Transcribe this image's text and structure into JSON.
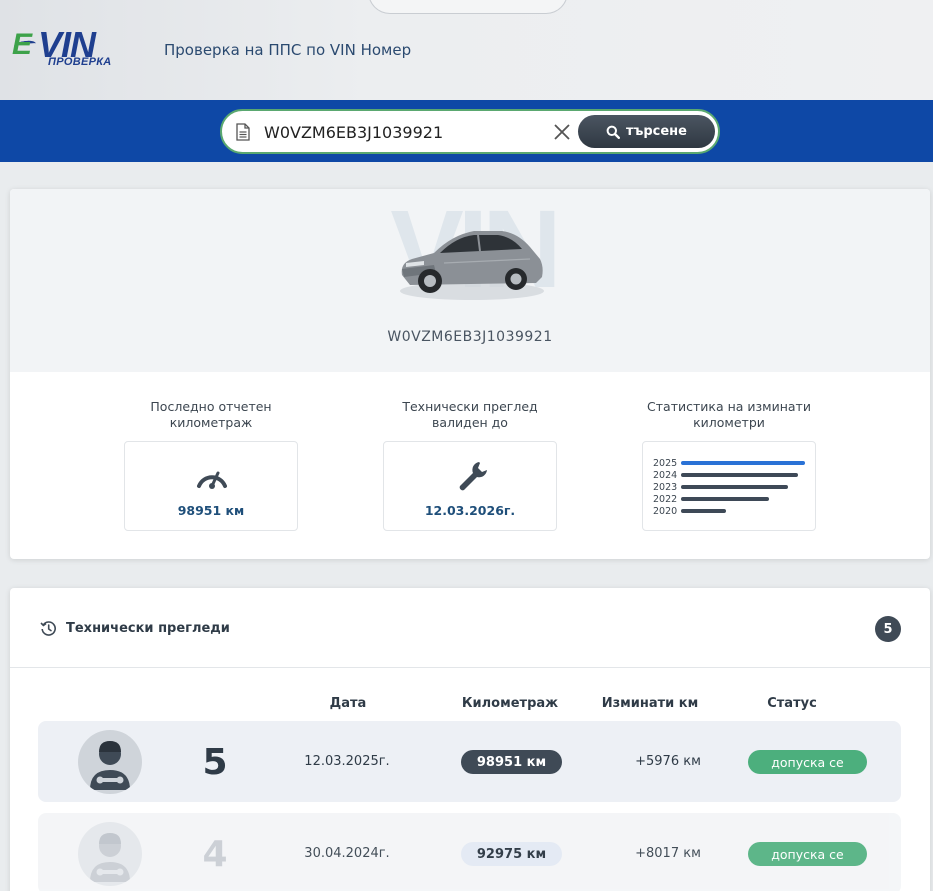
{
  "header": {
    "logo": {
      "brand_e": "E",
      "brand_vin": "VIN",
      "brand_sub": "ПРОВЕРКА"
    },
    "tagline": "Проверка на ППС по VIN Номер"
  },
  "search": {
    "value": "W0VZM6EB3J1039921",
    "button_label": "търсене",
    "icons": {
      "document": "document-icon",
      "clear": "close-icon",
      "search": "search-icon"
    }
  },
  "vehicle": {
    "watermark": "VIN",
    "vin": "W0VZM6EB3J1039921",
    "stats": {
      "mileage": {
        "label": "Последно отчетен километраж",
        "value": "98951 км",
        "icon": "speedometer-icon"
      },
      "inspection": {
        "label": "Технически преглед валиден до",
        "value": "12.03.2026г.",
        "icon": "wrench-icon"
      },
      "yearly": {
        "label": "Статистика на изминати километри",
        "years": [
          "2025",
          "2024",
          "2023",
          "2022",
          "2020"
        ],
        "relative_km": [
          1.0,
          0.94,
          0.86,
          0.71,
          0.36
        ],
        "colors": {
          "highlight": "#2a72d6",
          "default": "#3e4957"
        }
      }
    }
  },
  "inspections": {
    "title": "Технически прегледи",
    "count": "5",
    "columns": {
      "date": "Дата",
      "mileage": "Километраж",
      "delta": "Изминати км",
      "status": "Статус"
    },
    "rows": [
      {
        "num": "5",
        "date": "12.03.2025г.",
        "km": "98951 км",
        "delta": "+5976 км",
        "status": "допуска се"
      },
      {
        "num": "4",
        "date": "30.04.2024г.",
        "km": "92975 км",
        "delta": "+8017 км",
        "status": "допуска се"
      }
    ]
  },
  "colors": {
    "brand_blue": "#0e48a6",
    "accent_green": "#4caf7d",
    "dark": "#3f4a56"
  }
}
